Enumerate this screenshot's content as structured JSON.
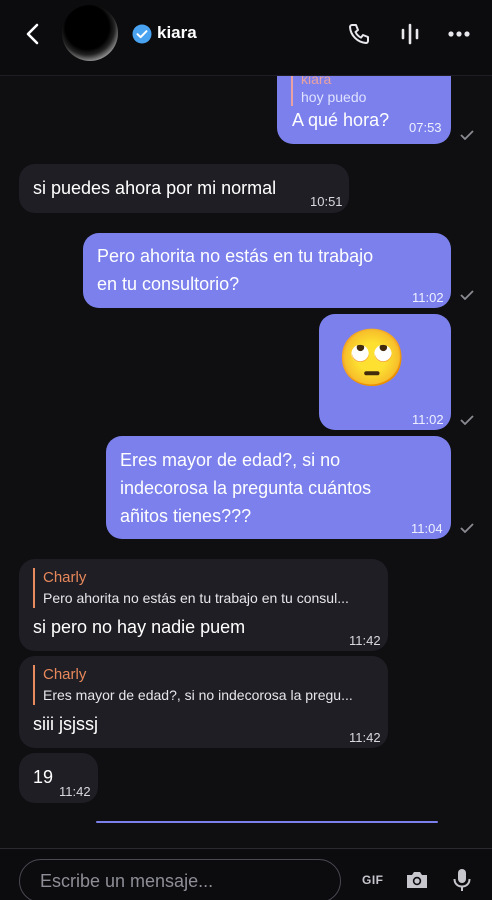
{
  "header": {
    "username": "kiara",
    "icons": [
      "back-arrow-icon",
      "verified-badge-icon",
      "phone-icon",
      "audio-waveform-icon",
      "more-dots-icon"
    ]
  },
  "colors": {
    "outgoing_bubble": "#7b80ec",
    "incoming_bubble": "#1e1e24",
    "background": "#0f0f12",
    "reply_accent": "#e88b5f"
  },
  "messages": [
    {
      "direction": "out",
      "reply_to_name": "kiara",
      "reply_to_text": "hoy puedo",
      "text": "A qué hora?",
      "time": "07:53"
    },
    {
      "direction": "in",
      "text": "si puedes ahora por mi normal",
      "time": "10:51"
    },
    {
      "direction": "out",
      "text_line1": "Pero ahorita no estás en tu trabajo",
      "text_line2": "en tu consultorio?",
      "time": "11:02"
    },
    {
      "direction": "out",
      "emoji": "🙄",
      "time": "11:02"
    },
    {
      "direction": "out",
      "text_line1": "Eres mayor de edad?, si no",
      "text_line2": "indecorosa la pregunta cuántos",
      "text_line3": "añitos tienes???",
      "time": "11:04"
    },
    {
      "direction": "in",
      "reply_to_name": "Charly",
      "reply_to_text": "Pero ahorita no estás en tu trabajo en tu consul...",
      "text": "si pero no hay nadie puem",
      "time": "11:42"
    },
    {
      "direction": "in",
      "reply_to_name": "Charly",
      "reply_to_text": "Eres mayor de edad?, si no indecorosa la pregu...",
      "text": "siii jsjssj",
      "time": "11:42"
    },
    {
      "direction": "in",
      "text": "19",
      "time": "11:42"
    }
  ],
  "composer": {
    "placeholder": "Escribe un mensaje...",
    "gif_label": "GIF",
    "icons": [
      "camera-icon",
      "microphone-icon"
    ]
  }
}
